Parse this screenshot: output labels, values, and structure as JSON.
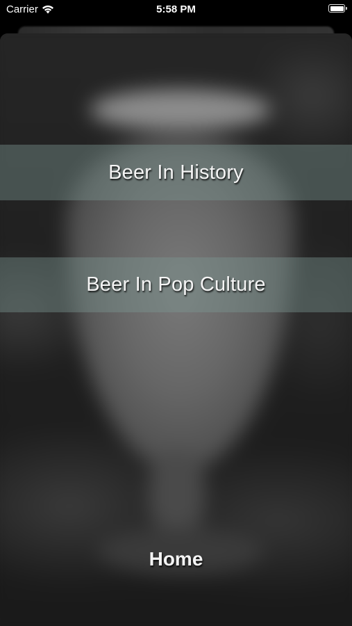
{
  "status_bar": {
    "carrier": "Carrier",
    "time": "5:58 PM",
    "wifi_icon": "wifi-icon",
    "battery_icon": "battery-icon"
  },
  "menu": {
    "items": [
      {
        "label": "Beer In History"
      },
      {
        "label": "Beer In Pop Culture"
      }
    ],
    "band_color": "#7d9691"
  },
  "footer": {
    "home_label": "Home"
  }
}
